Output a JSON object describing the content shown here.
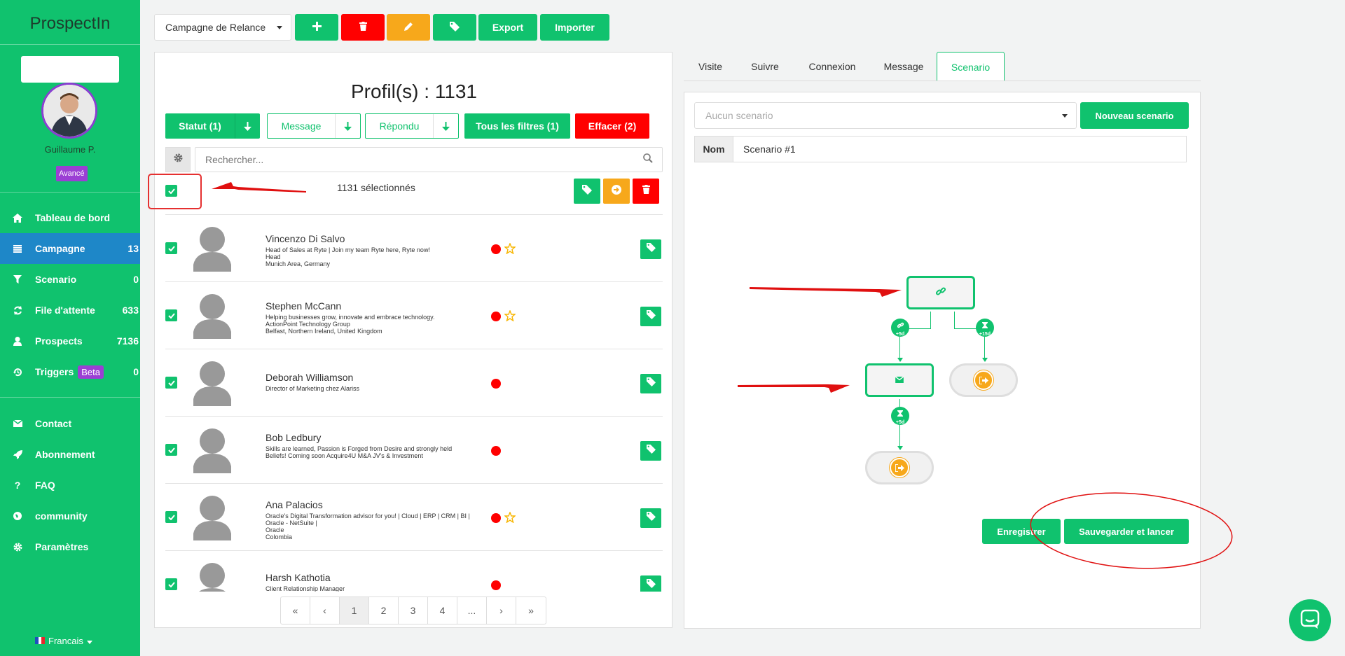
{
  "sidebar": {
    "brand": "ProspectIn",
    "user_name": "Guillaume P.",
    "user_badge": "Avancé",
    "nav": [
      {
        "label": "Tableau de bord",
        "count": "",
        "icon": "home-icon"
      },
      {
        "label": "Campagne",
        "count": "13",
        "icon": "list-icon"
      },
      {
        "label": "Scenario",
        "count": "0",
        "icon": "filter-icon"
      },
      {
        "label": "File d'attente",
        "count": "633",
        "icon": "refresh-icon"
      },
      {
        "label": "Prospects",
        "count": "7136",
        "icon": "user-icon"
      },
      {
        "label": "Triggers",
        "count": "0",
        "badge": "Beta",
        "icon": "history-icon"
      },
      {
        "label": "Contact",
        "count": "",
        "icon": "envelope-icon"
      },
      {
        "label": "Abonnement",
        "count": "",
        "icon": "rocket-icon"
      },
      {
        "label": "FAQ",
        "count": "",
        "icon": "question-icon"
      },
      {
        "label": "community",
        "count": "",
        "icon": "globe-icon"
      },
      {
        "label": "Paramètres",
        "count": "",
        "icon": "gear-icon"
      }
    ],
    "language": "Francais"
  },
  "toolbar": {
    "campaign": "Campagne de Relance",
    "export_label": "Export",
    "import_label": "Importer"
  },
  "profiles": {
    "title": "Profil(s) : 1131",
    "filters": {
      "statut": "Statut (1)",
      "message": "Message",
      "repondu": "Répondu",
      "all_filters": "Tous les filtres (1)",
      "clear": "Effacer (2)"
    },
    "search_placeholder": "Rechercher...",
    "selected_count": "1131 sélectionnés",
    "rows": [
      {
        "name": "Vincenzo Di Salvo",
        "desc": [
          "Head of Sales at Ryte | Join my team Ryte here, Ryte now!",
          "Head",
          "Munich Area, Germany"
        ],
        "star": true
      },
      {
        "name": "Stephen McCann",
        "desc": [
          "Helping businesses grow, innovate and embrace technology.",
          "ActionPoint Technology Group",
          "Belfast, Northern Ireland, United Kingdom"
        ],
        "star": true
      },
      {
        "name": "Deborah Williamson",
        "desc": [
          "Director of Marketing chez Alariss"
        ],
        "star": false
      },
      {
        "name": "Bob Ledbury",
        "desc": [
          "Skills are learned, Passion is Forged from Desire and strongly held",
          "Beliefs! Coming soon Acquire4U M&A JV's & Investment"
        ],
        "star": false
      },
      {
        "name": "Ana Palacios",
        "desc": [
          "Oracle's Digital Transformation advisor for you! | Cloud | ERP | CRM | BI |",
          "Oracle - NetSuite |",
          "Oracle",
          "Colombia"
        ],
        "star": true
      },
      {
        "name": "Harsh Kathotia",
        "desc": [
          "Client Relationship Manager"
        ],
        "star": false
      }
    ],
    "pagination": [
      "«",
      "‹",
      "1",
      "2",
      "3",
      "4",
      "...",
      "›",
      "»"
    ],
    "current_page": "1"
  },
  "tabs": [
    "Visite",
    "Suivre",
    "Connexion",
    "Message",
    "Scenario"
  ],
  "active_tab": "Scenario",
  "scenario": {
    "select_placeholder": "Aucun scenario",
    "new_button": "Nouveau scenario",
    "name_label": "Nom",
    "name_value": "Scenario #1",
    "flow": {
      "delays": [
        "+5d",
        "+15d",
        "+5d"
      ]
    },
    "save_label": "Enregistrer",
    "save_launch_label": "Sauvegarder et lancer"
  },
  "colors": {
    "brand_green": "#10c26e",
    "active_blue": "#1e87c8",
    "danger_red": "#ff0000",
    "warning_orange": "#f7a81b",
    "badge_purple": "#9b3fd4"
  }
}
